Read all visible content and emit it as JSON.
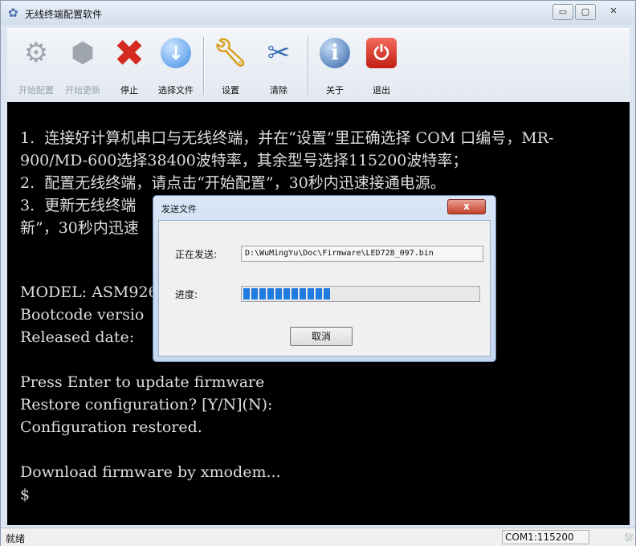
{
  "window": {
    "title": "无线终端配置软件",
    "minimize": "▭",
    "maximize": "▢",
    "close": "✕"
  },
  "toolbar": {
    "items": [
      {
        "label": "开始配置",
        "icon": "gears-icon",
        "enabled": false
      },
      {
        "label": "开始更新",
        "icon": "box-arrow-icon",
        "enabled": false
      },
      {
        "label": "停止",
        "icon": "red-x-icon",
        "enabled": true
      },
      {
        "label": "选择文件",
        "icon": "download-arrow-icon",
        "enabled": true
      },
      {
        "label": "设置",
        "icon": "wrench-icon",
        "enabled": true
      },
      {
        "label": "清除",
        "icon": "scissors-icon",
        "enabled": true
      },
      {
        "label": "关于",
        "icon": "info-icon",
        "enabled": true
      },
      {
        "label": "退出",
        "icon": "power-icon",
        "enabled": true
      }
    ]
  },
  "console": {
    "lines": [
      "1.  连接好计算机串口与无线终端，并在“设置”里正确选择 COM 口编号，MR-",
      "900/MD-600选择38400波特率，其余型号选择115200波特率；",
      "2.  配置无线终端，请点击“开始配置”，30秒内迅速接通电源。",
      "3.  更新无线终端                                 点击“开始更",
      "新”，30秒内迅速",
      "",
      "",
      "MODEL: ASM9260T",
      "Bootcode versio",
      "Released date: ",
      "",
      "Press Enter to update firmware",
      "Restore configuration? [Y/N](N):",
      "Configuration restored.",
      "",
      "Download firmware by xmodem...",
      "$"
    ]
  },
  "dialog": {
    "title": "发送文件",
    "close": "x",
    "sending_label": "正在发送:",
    "file_path": "D:\\WuMingYu\\Doc\\Firmware\\LED728_097.bin",
    "progress_label": "进度:",
    "progress_fraction": 0.37,
    "cancel": "取消"
  },
  "status": {
    "left": "就绪",
    "port": "COM1:115200"
  },
  "colors": {
    "console_bg": "#000000",
    "console_text": "#dedede",
    "progress": "#1f7be0",
    "close_red": "#c4402a"
  }
}
